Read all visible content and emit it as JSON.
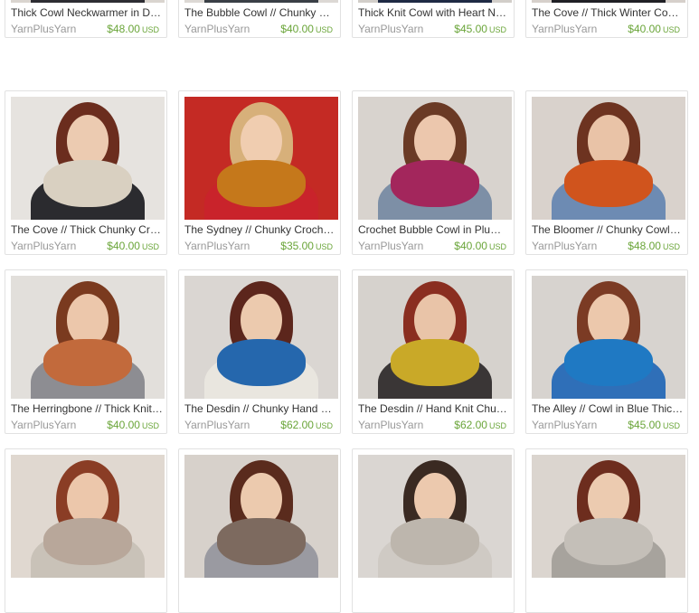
{
  "listings": [
    {
      "title": "Thick Cowl Neckwarmer in D…",
      "shop": "YarnPlusYarn",
      "price": "$48.00",
      "currency": "USD",
      "image": "model-in-blue-cowl-photo"
    },
    {
      "title": "The Bubble Cowl // Chunky C…",
      "shop": "YarnPlusYarn",
      "price": "$40.00",
      "currency": "USD",
      "image": "model-in-teal-cowl-photo"
    },
    {
      "title": "Thick Knit Cowl with Heart N…",
      "shop": "YarnPlusYarn",
      "price": "$45.00",
      "currency": "USD",
      "image": "model-in-grey-cowl-photo"
    },
    {
      "title": "The Cove // Thick Winter Co…",
      "shop": "YarnPlusYarn",
      "price": "$40.00",
      "currency": "USD",
      "image": "model-in-red-cowl-photo"
    },
    {
      "title": "The Cove // Thick Chunky Cr…",
      "shop": "YarnPlusYarn",
      "price": "$40.00",
      "currency": "USD",
      "image": "model-in-cream-cowl-photo"
    },
    {
      "title": "The Sydney // Chunky Croch…",
      "shop": "YarnPlusYarn",
      "price": "$35.00",
      "currency": "USD",
      "image": "model-in-snow-photo"
    },
    {
      "title": "Crochet Bubble Cowl in Plum…",
      "shop": "YarnPlusYarn",
      "price": "$40.00",
      "currency": "USD",
      "image": "model-in-plum-cowl-photo"
    },
    {
      "title": "The Bloomer // Chunky Cowl …",
      "shop": "YarnPlusYarn",
      "price": "$48.00",
      "currency": "USD",
      "image": "model-in-orange-cowl-photo"
    },
    {
      "title": "The Herringbone // Thick Knit…",
      "shop": "YarnPlusYarn",
      "price": "$40.00",
      "currency": "USD",
      "image": "model-in-rust-cowl-photo"
    },
    {
      "title": "The Desdin // Chunky Hand …",
      "shop": "YarnPlusYarn",
      "price": "$62.00",
      "currency": "USD",
      "image": "model-in-blue-striped-scarf-photo"
    },
    {
      "title": "The Desdin // Hand Knit Chu…",
      "shop": "YarnPlusYarn",
      "price": "$62.00",
      "currency": "USD",
      "image": "model-in-yellow-striped-scarf-photo"
    },
    {
      "title": "The Alley // Cowl in Blue Thic…",
      "shop": "YarnPlusYarn",
      "price": "$45.00",
      "currency": "USD",
      "image": "model-in-bright-blue-cowl-photo"
    },
    {
      "title": "",
      "shop": "",
      "price": "",
      "currency": "",
      "image": "listing-photo-partial"
    },
    {
      "title": "",
      "shop": "",
      "price": "",
      "currency": "",
      "image": "listing-photo-partial"
    },
    {
      "title": "",
      "shop": "",
      "price": "",
      "currency": "",
      "image": "listing-photo-partial"
    },
    {
      "title": "",
      "shop": "",
      "price": "",
      "currency": "",
      "image": "listing-photo-partial"
    }
  ],
  "colors": {
    "price_green": "#6aa539",
    "shop_grey": "#999999",
    "title_text": "#333333",
    "card_border": "#e1e1e1"
  }
}
